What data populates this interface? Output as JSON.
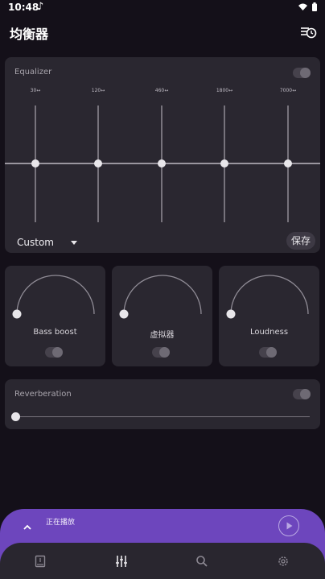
{
  "status": {
    "time": "10:48",
    "music_icon": "music-note-icon",
    "wifi_icon": "wifi-icon",
    "battery_icon": "battery-icon"
  },
  "appbar": {
    "title": "均衡器",
    "action_icon": "playlist-timer-icon"
  },
  "equalizer": {
    "label": "Equalizer",
    "enabled": false,
    "bands": [
      {
        "freq": "30↔",
        "level": 0
      },
      {
        "freq": "120↔",
        "level": 0
      },
      {
        "freq": "460↔",
        "level": 0
      },
      {
        "freq": "1800↔",
        "level": 0
      },
      {
        "freq": "7000↔",
        "level": 0
      }
    ],
    "preset": "Custom",
    "save_label": "保存"
  },
  "effects": [
    {
      "label": "Bass boost",
      "enabled": false,
      "level": 0
    },
    {
      "label": "虚拟器",
      "enabled": false,
      "level": 0
    },
    {
      "label": "Loudness",
      "enabled": false,
      "level": 0
    }
  ],
  "reverberation": {
    "label": "Reverberation",
    "enabled": false,
    "level": 0
  },
  "player": {
    "status": "正在播放"
  },
  "nav": {
    "items": [
      "library-icon",
      "equalizer-icon",
      "search-icon",
      "settings-icon"
    ],
    "active": 1
  },
  "colors": {
    "accent": "#6d46bd",
    "background": "#141019",
    "card": "#2a2730"
  }
}
